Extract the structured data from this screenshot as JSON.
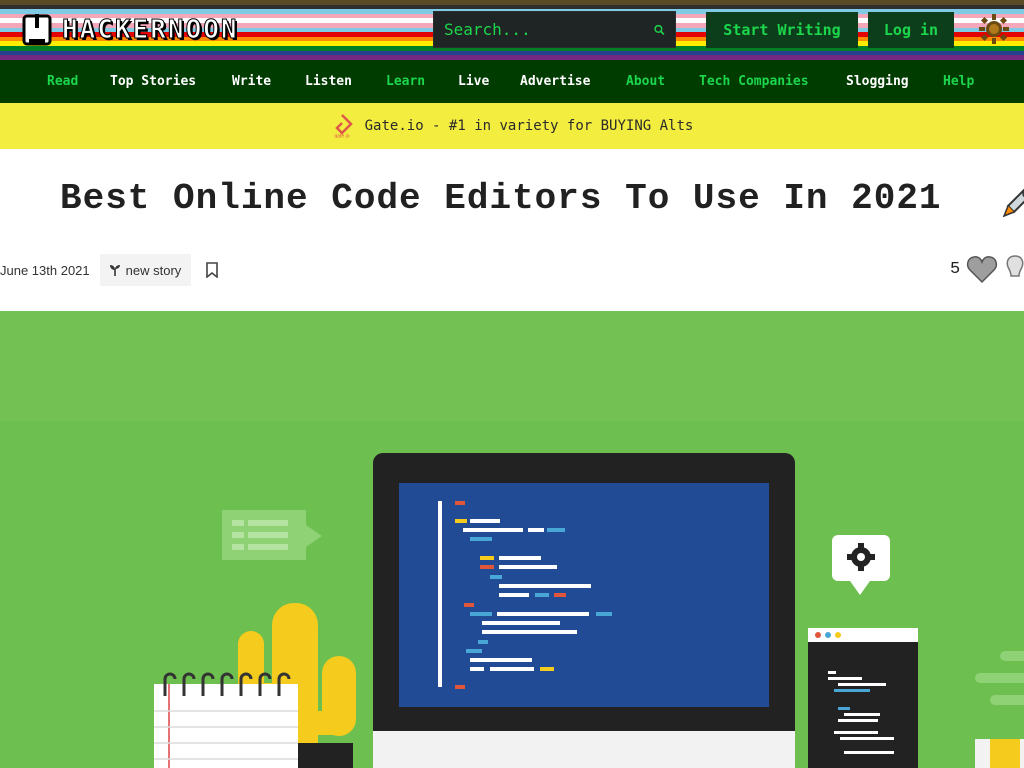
{
  "header": {
    "logo_text": "HACKERNOON",
    "search_placeholder": "Search...",
    "start_writing": "Start Writing",
    "login": "Log in",
    "icons": {
      "search": "search-icon",
      "theme": "sun-icon",
      "logo": "hackernoon-helmet-icon"
    }
  },
  "nav": {
    "items": [
      {
        "label": "Read",
        "highlight": true
      },
      {
        "label": "Top Stories",
        "highlight": false
      },
      {
        "label": "Write",
        "highlight": false
      },
      {
        "label": "Listen",
        "highlight": false
      },
      {
        "label": "Learn",
        "highlight": true
      },
      {
        "label": "Live",
        "highlight": false
      },
      {
        "label": "Advertise",
        "highlight": false
      },
      {
        "label": "About",
        "highlight": true
      },
      {
        "label": "Tech Companies",
        "highlight": true
      },
      {
        "label": "Slogging",
        "highlight": false
      },
      {
        "label": "Help",
        "highlight": true
      }
    ]
  },
  "banner": {
    "text": "Gate.io - #1 in variety for BUYING Alts",
    "logo_caption": "gate.io"
  },
  "article": {
    "title": "Best Online Code Editors To Use In 2021",
    "date": "June 13th 2021",
    "tag": "new story",
    "reaction_count": "5"
  },
  "colors": {
    "nav_bg": "#003b00",
    "accent_green": "#1cd64b",
    "banner_bg": "#f2ed3f",
    "hero_bg": "#6dbf4f",
    "stripes": [
      "#6a5b2c",
      "#c9c9c9",
      "#f7a8b8",
      "#ffffff",
      "#e40303",
      "#ff8c00",
      "#ffed00",
      "#008026",
      "#24408e",
      "#732982"
    ]
  }
}
